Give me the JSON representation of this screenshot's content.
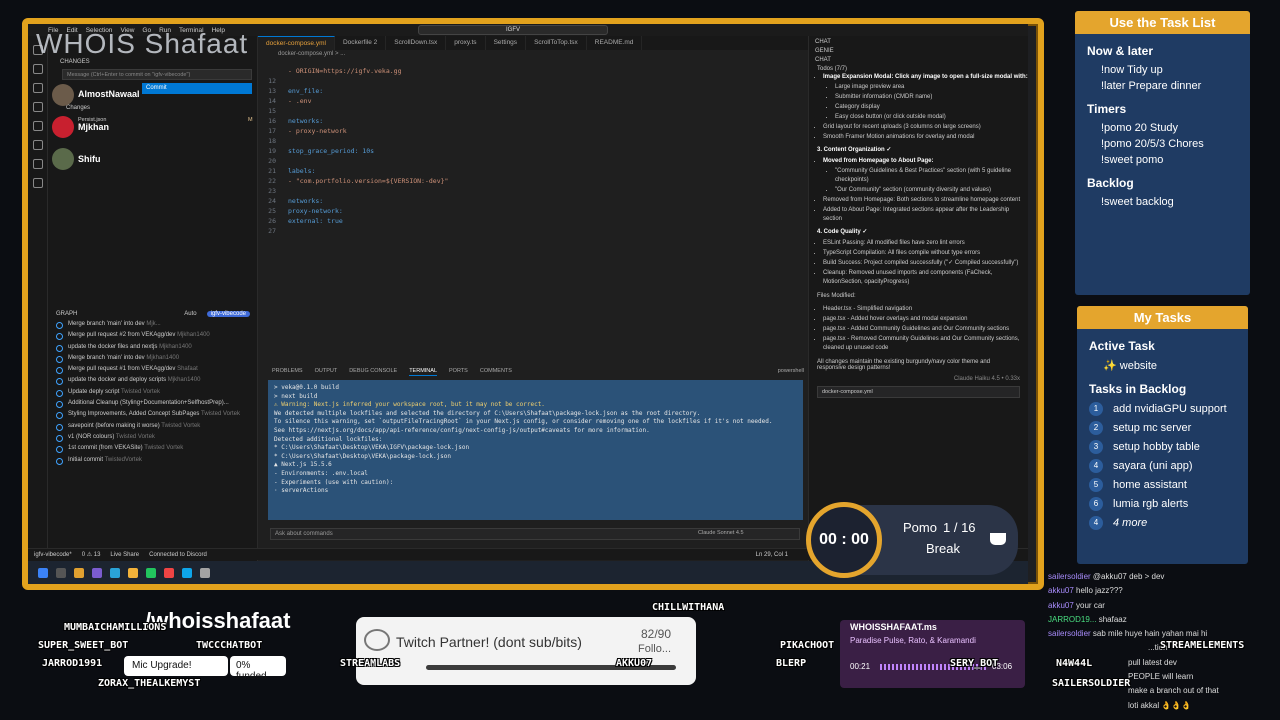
{
  "overlay_title": "WHOIS Shafaat",
  "vscode": {
    "menu": [
      "File",
      "Edit",
      "Selection",
      "View",
      "Go",
      "Run",
      "Terminal",
      "Help"
    ],
    "search": "IGFV",
    "source_control": {
      "header": "SOURCE CONTROL",
      "changes": "CHANGES",
      "message_placeholder": "Message (Ctrl+Enter to commit on \"igfv-vibecode\")",
      "commit": "Commit",
      "changes_sub": "Changes",
      "file": "Persist.json",
      "file_flag": "M"
    },
    "graph": {
      "header": "GRAPH",
      "auto": "Auto",
      "branch_badge": "igfv-vibecode",
      "rows": [
        {
          "msg": "Merge branch 'main' into dev",
          "author": "Mjk..."
        },
        {
          "msg": "Merge pull request #2 from VEKAgg/dev",
          "author": "Mjkhan1400"
        },
        {
          "msg": "update the docker files and nextjs",
          "author": "Mjkhan1400"
        },
        {
          "msg": "Merge branch 'main' into dev",
          "author": "Mjkhan1400"
        },
        {
          "msg": "Merge pull request #1 from VEKAgg/dev",
          "author": "Shafaat"
        },
        {
          "msg": "update the docker and deploy scripts",
          "author": "Mjkhan1400"
        },
        {
          "msg": "Update deply script",
          "author": "Twisted Vortek"
        },
        {
          "msg": "Additional Cleanup (Styling+Documentation+SelfhostPrep)...",
          "author": ""
        },
        {
          "msg": "Styling Improvements, Added Concept SubPages",
          "author": "Twisted Vortek"
        },
        {
          "msg": "savepoint (before making it worse)",
          "author": "Twisted Vortek"
        },
        {
          "msg": "v1 (NOR colours)",
          "author": "Twisted Vortek"
        },
        {
          "msg": "1st commit (from VEKASite)",
          "author": "Twisted Vortek"
        },
        {
          "msg": "Initial commit",
          "author": "TwistedVortek"
        }
      ]
    },
    "tabs": [
      "docker-compose.yml",
      "Dockerfile 2",
      "ScrollDown.tsx",
      "proxy.ts",
      "Settings",
      "ScrollToTop.tsx",
      "README.md"
    ],
    "breadcrumb": "docker-compose.yml > ...",
    "code": [
      {
        "n": "",
        "t": "      - ORIGIN=https://igfv.veka.gg"
      },
      {
        "n": "12",
        "t": ""
      },
      {
        "n": "13",
        "t": "    env_file:"
      },
      {
        "n": "14",
        "t": "      - .env"
      },
      {
        "n": "15",
        "t": ""
      },
      {
        "n": "16",
        "t": "    networks:"
      },
      {
        "n": "17",
        "t": "      - proxy-network"
      },
      {
        "n": "18",
        "t": ""
      },
      {
        "n": "19",
        "t": "    stop_grace_period: 10s"
      },
      {
        "n": "20",
        "t": ""
      },
      {
        "n": "21",
        "t": "    labels:"
      },
      {
        "n": "22",
        "t": "      - \"com.portfolio.version=${VERSION:-dev}\""
      },
      {
        "n": "23",
        "t": ""
      },
      {
        "n": "24",
        "t": "networks:"
      },
      {
        "n": "25",
        "t": "  proxy-network:"
      },
      {
        "n": "26",
        "t": "    external: true"
      },
      {
        "n": "27",
        "t": ""
      }
    ],
    "panel_tabs": [
      "PROBLEMS",
      "OUTPUT",
      "DEBUG CONSOLE",
      "TERMINAL",
      "PORTS",
      "COMMENTS"
    ],
    "panel_shell": "powershell",
    "terminal": [
      "> veka@0.1.0 build",
      "> next build",
      "",
      "⚠ Warning: Next.js inferred your workspace root, but it may not be correct.",
      " We detected multiple lockfiles and selected the directory of C:\\Users\\Shafaat\\package-lock.json as the root directory.",
      " To silence this warning, set `outputFileTracingRoot` in your Next.js config, or consider removing one of the lockfiles if it's not needed.",
      "   See https://nextjs.org/docs/app/api-reference/config/next-config-js/output#caveats for more information.",
      " Detected additional lockfiles:",
      "   * C:\\Users\\Shafaat\\Desktop\\VEKA\\IGFV\\package-lock.json",
      "   * C:\\Users\\Shafaat\\Desktop\\VEKA\\package-lock.json",
      "",
      "  ▲ Next.js 15.5.6",
      "  - Environments: .env.local",
      "  - Experiments (use with caution):",
      "    · serverActions"
    ],
    "ask_placeholder": "Ask about commands",
    "model": "Claude Sonnet 4.5",
    "status": {
      "branch": "igfv-vibecode*",
      "errors": "0 ⚠ 13",
      "live": "Live Share",
      "discord": "Connected to Discord",
      "pos": "Ln 29, Col 1"
    },
    "chat": {
      "title": "CHAT",
      "genie": "GENIE",
      "sub": "CHAT",
      "todos": "Todos (7/7)",
      "lines": [
        "Image Expansion Modal: Click any image to open a full-size modal with:",
        "Large image preview area",
        "Submitter information (CMDR name)",
        "Category display",
        "Easy close button (or click outside modal)",
        "Grid layout for recent uploads (3 columns on large screens)",
        "Smooth Framer Motion animations for overlay and modal",
        "3. Content Organization ✓",
        "Moved from Homepage to About Page:",
        "\"Community Guidelines & Best Practices\" section (with 5 guideline checkpoints)",
        "\"Our Community\" section (community diversity and values)",
        "Removed from Homepage: Both sections to streamline homepage content",
        "Added to About Page: Integrated sections appear after the Leadership section",
        "4. Code Quality ✓",
        "ESLint Passing: All modified files have zero lint errors",
        "TypeScript Compilation: All files compile without type errors",
        "Build Success: Project compiled successfully (\"✓ Compiled successfully\")",
        "Cleanup: Removed unused imports and components (FaCheck, MotionSection, opacityProgress)",
        "Files Modified:",
        "Header.tsx - Simplified navigation",
        "page.tsx - Added hover overlays and modal expansion",
        "page.tsx - Added Community Guidelines and Our Community sections",
        "page.tsx - Removed Community Guidelines and Our Community sections, cleaned up unused code",
        "All changes maintain the existing burgundy/navy color theme and responsive design patterns!"
      ],
      "footer": "Claude Haiku 4.5 • 0.33x",
      "attach": "docker-compose.yml"
    }
  },
  "task_list": {
    "title": "Use the Task List",
    "sections": [
      {
        "h": "Now & later",
        "items": [
          "!now Tidy up",
          "!later Prepare dinner"
        ]
      },
      {
        "h": "Timers",
        "items": [
          "!pomo 20 Study",
          "!pomo 20/5/3 Chores",
          "!sweet pomo"
        ]
      },
      {
        "h": "Backlog",
        "items": [
          "!sweet backlog"
        ]
      }
    ]
  },
  "my_tasks": {
    "title": "My Tasks",
    "active_h": "Active Task",
    "active": "✨ website",
    "backlog_h": "Tasks in Backlog",
    "backlog": [
      "add nvidiaGPU support",
      "setup mc server",
      "setup hobby table",
      "sayara (uni app)",
      "home assistant",
      "lumia rgb alerts"
    ],
    "more": "4 more",
    "nums": [
      "1",
      "2",
      "3",
      "4",
      "5",
      "6",
      "4"
    ]
  },
  "pomo": {
    "time": "00 : 00",
    "label": "Pomo",
    "count": "1 / 16",
    "state": "Break"
  },
  "chatlog": [
    {
      "u": "sailersoldier",
      "m": "@akku07 deb > dev"
    },
    {
      "u": "akku07",
      "m": "hello jazz???"
    },
    {
      "u": "akku07",
      "m": "your car"
    },
    {
      "u": "JARROD19...",
      "m": "shafaaz"
    },
    {
      "u": "sailersoldier",
      "m": "sab mile huye hain yahan mai hi"
    },
    {
      "u": "",
      "m": "...tion"
    },
    {
      "u": "",
      "m": "pull latest dev"
    },
    {
      "u": "",
      "m": "PEOPLE will learn"
    },
    {
      "u": "",
      "m": "make a branch out of that"
    },
    {
      "u": "",
      "m": "loti akkal 👌👌👌"
    }
  ],
  "bottom": {
    "handle": "/whoisshafaat",
    "partner": "Twitch Partner! (dont sub/bits)",
    "followers": "82/90",
    "follow_label": "Follo...",
    "mic": "Mic Upgrade!",
    "funded": "0% funded",
    "music_user": "WHOISSHAFAAT.ms",
    "song": "Paradise Pulse, Rato, & Karamandi",
    "song_time": "00:21",
    "song_remaining": "03:06",
    "names": [
      "MUMBAICHAMILLIONS",
      "SUPER_SWEET_BOT",
      "TWCCCHATBOT",
      "JARROD1991",
      "ZORAX_THEALKEMYST",
      "STREAMLABS",
      "AKKU07",
      "CHILLWITHANA",
      "PIKACHOOT",
      "BLERP",
      "SERY_BOT",
      "STREAMELEMENTS",
      "N4W44L",
      "SAILERSOLDIER"
    ]
  },
  "avatars": [
    {
      "name": "AlmostNawaal"
    },
    {
      "name": "Mjkhan"
    },
    {
      "name": "Shifu"
    }
  ],
  "colors": {
    "accent": "#e4a52d",
    "navy": "#1f3b63",
    "vs_blue": "#0078d4",
    "terminal": "#2b5278"
  }
}
